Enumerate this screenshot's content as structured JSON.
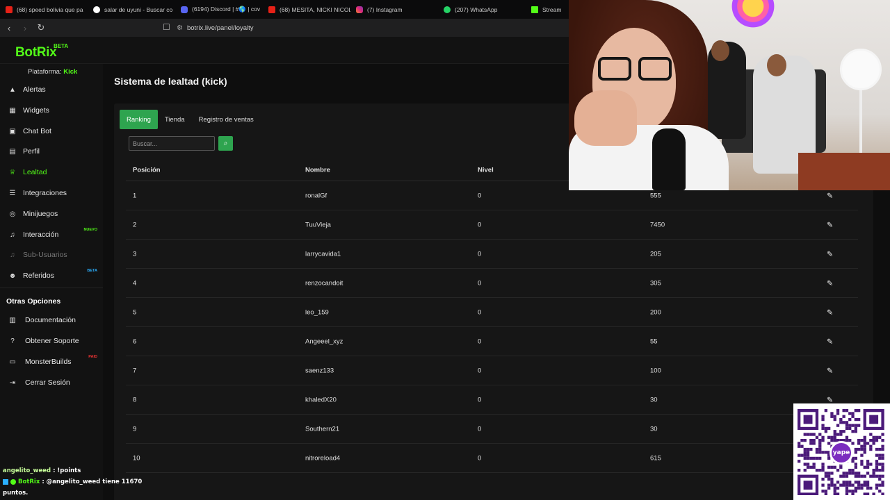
{
  "browser": {
    "tabs": [
      {
        "title": "(68) speed bolivia que pa",
        "icon": "youtube-icon"
      },
      {
        "title": "salar de uyuni - Buscar co",
        "icon": "google-icon"
      },
      {
        "title": "(6194) Discord | #🌎 | cov",
        "icon": "discord-icon"
      },
      {
        "title": "(68) MESITA, NICKI NICOL",
        "icon": "youtube-icon"
      },
      {
        "title": "(7) Instagram",
        "icon": "instagram-icon"
      },
      {
        "title": "(207) WhatsApp",
        "icon": "whatsapp-icon"
      },
      {
        "title": "Stream",
        "icon": "kick-icon"
      }
    ],
    "url": "botrix.live/panel/loyalty"
  },
  "header": {
    "logo": "BotRix",
    "logo_badge": "BETA"
  },
  "sidebar": {
    "platform_label": "Plataforma:",
    "platform_value": "Kick",
    "items": [
      {
        "label": "Alertas",
        "icon": "warning-icon"
      },
      {
        "label": "Widgets",
        "icon": "grid-icon"
      },
      {
        "label": "Chat Bot",
        "icon": "robot-icon"
      },
      {
        "label": "Perfil",
        "icon": "id-card-icon"
      },
      {
        "label": "Lealtad",
        "icon": "trophy-icon",
        "active": true
      },
      {
        "label": "Integraciones",
        "icon": "list-icon"
      },
      {
        "label": "Minijuegos",
        "icon": "gamepad-icon"
      },
      {
        "label": "Interacción",
        "icon": "music-icon",
        "badge": "NUEVO"
      },
      {
        "label": "Sub-Usuarios",
        "icon": "music-icon",
        "disabled": true
      },
      {
        "label": "Referidos",
        "icon": "users-icon",
        "badge": "BETA"
      }
    ],
    "other_title": "Otras Opciones",
    "other_items": [
      {
        "label": "Documentación",
        "icon": "book-icon"
      },
      {
        "label": "Obtener Soporte",
        "icon": "question-icon"
      },
      {
        "label": "MonsterBuilds",
        "icon": "desktop-icon",
        "badge": "PAID"
      },
      {
        "label": "Cerrar Sesión",
        "icon": "logout-icon"
      }
    ]
  },
  "main": {
    "title": "Sistema de lealtad (kick)",
    "tabs": [
      "Ranking",
      "Tienda",
      "Registro de ventas"
    ],
    "search_placeholder": "Buscar...",
    "columns": [
      "Posición",
      "Nombre",
      "Nivel",
      ""
    ],
    "rows": [
      {
        "pos": "1",
        "name": "ronalGf",
        "level": "0",
        "points": "555"
      },
      {
        "pos": "2",
        "name": "TuuVieja",
        "level": "0",
        "points": "7450"
      },
      {
        "pos": "3",
        "name": "larrycavida1",
        "level": "0",
        "points": "205"
      },
      {
        "pos": "4",
        "name": "renzocandoit",
        "level": "0",
        "points": "305"
      },
      {
        "pos": "5",
        "name": "leo_159",
        "level": "0",
        "points": "200"
      },
      {
        "pos": "6",
        "name": "Angeeel_xyz",
        "level": "0",
        "points": "55"
      },
      {
        "pos": "7",
        "name": "saenz133",
        "level": "0",
        "points": "100"
      },
      {
        "pos": "8",
        "name": "khaledX20",
        "level": "0",
        "points": "30"
      },
      {
        "pos": "9",
        "name": "Southern21",
        "level": "0",
        "points": "30"
      },
      {
        "pos": "10",
        "name": "nitroreload4",
        "level": "0",
        "points": "615"
      }
    ]
  },
  "overlay": {
    "qr_logo": "yape",
    "chat": [
      {
        "user": "angelito_weed",
        "text": ": !points"
      },
      {
        "user": "BotRix",
        "text": ": @angelito_weed tiene 11670"
      },
      {
        "user": "",
        "text": "puntos."
      }
    ]
  },
  "colors": {
    "accent": "#53fc18",
    "button_green": "#2ea44f",
    "background": "#0e0e0e"
  }
}
